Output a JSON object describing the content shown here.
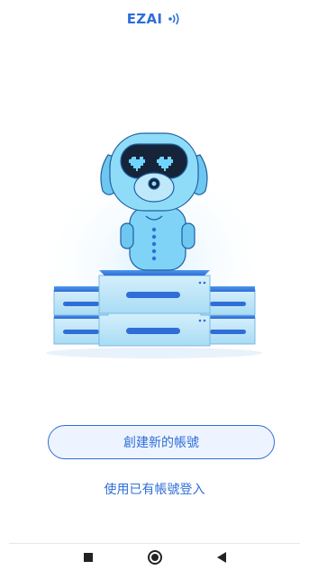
{
  "header": {
    "brand": "EZAI",
    "brand_icon": "signal-waves-icon"
  },
  "hero": {
    "illustration": "robot-on-server-stack"
  },
  "actions": {
    "create_account_label": "創建新的帳號",
    "login_existing_label": "使用已有帳號登入"
  },
  "system_nav": {
    "recents_icon": "square-icon",
    "home_icon": "circle-icon",
    "back_icon": "triangle-back-icon"
  },
  "colors": {
    "accent": "#2f6ed8",
    "robot": "#7fd3f7",
    "server": "#bfe6f8"
  }
}
